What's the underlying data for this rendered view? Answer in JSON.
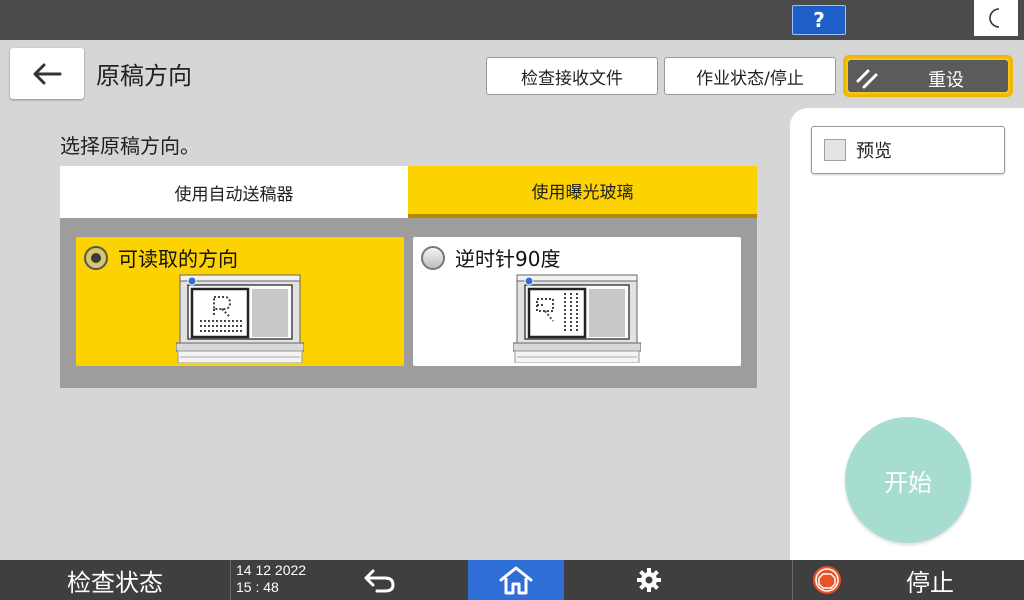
{
  "topbar": {
    "help_label": "?"
  },
  "header": {
    "title": "原稿方向",
    "check_received_label": "检查接收文件",
    "job_status_label": "作业状态/停止",
    "reset_label": "重设"
  },
  "main": {
    "instruction": "选择原稿方向。",
    "tabs": [
      {
        "label": "使用自动送稿器",
        "selected": false
      },
      {
        "label": "使用曝光玻璃",
        "selected": true
      }
    ],
    "options": [
      {
        "label": "可读取的方向",
        "selected": true
      },
      {
        "label": "逆时针90度",
        "selected": false
      }
    ]
  },
  "side": {
    "preview_label": "预览",
    "start_label": "开始"
  },
  "bottombar": {
    "status_label": "检查状态",
    "date": "14 12 2022",
    "time": "15 : 48",
    "stop_label": "停止"
  },
  "colors": {
    "accent_yellow": "#fcd200",
    "home_blue": "#2e6ed6",
    "start_teal": "#a6ddd0",
    "stop_orange": "#e8542a"
  }
}
